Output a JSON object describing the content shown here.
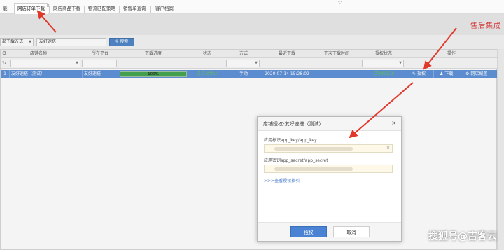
{
  "tabs": [
    {
      "label": "能",
      "active": false
    },
    {
      "label": "网店订单下载",
      "active": true
    },
    {
      "label": "网店商品下载",
      "active": false
    },
    {
      "label": "物流匹配策略",
      "active": false
    },
    {
      "label": "销售单查询",
      "active": false
    },
    {
      "label": "客户档案",
      "active": false
    }
  ],
  "tab_close_glyph": "×",
  "top_marker": "·:·",
  "header": {
    "text": "售后集成"
  },
  "filter": {
    "mode_select": "部下载方式",
    "search_value": "友好速搭",
    "search_button": "搜索"
  },
  "grid": {
    "columns": [
      "店铺名称",
      "所在平台",
      "下载进度",
      "状态",
      "方式",
      "最近下载",
      "下次下载时间",
      "授权状态",
      "操作"
    ],
    "row": {
      "index": "1",
      "store": "友好速搭（测试）",
      "platform": "友好速搭",
      "progress_percent": 100,
      "progress_label": "100%",
      "status": "已自动停止",
      "method": "手动",
      "last_download": "2020-07-14 15:28:02",
      "next_download": "",
      "auth_status": "已授权成功",
      "actions": [
        "授权",
        "下载",
        "网店配置"
      ]
    }
  },
  "dialog": {
    "title": "店铺授权-友好速搭（测试）",
    "close": "×",
    "field1_label": "应用标识app_key/app_key",
    "field2_label": "应用密钥app_secret/app_secret",
    "field_clear": "×",
    "guide_link": ">>>查看授权指引",
    "confirm_button": "授权",
    "cancel_button": "取消"
  },
  "watermark": "搜狐号@吉客云",
  "colors": {
    "row_highlight": "#5a8fd8",
    "progress_fill": "#3fa24a",
    "primary_button": "#4a83d4",
    "arrow": "#e0392b",
    "header_text": "#dd3333"
  }
}
